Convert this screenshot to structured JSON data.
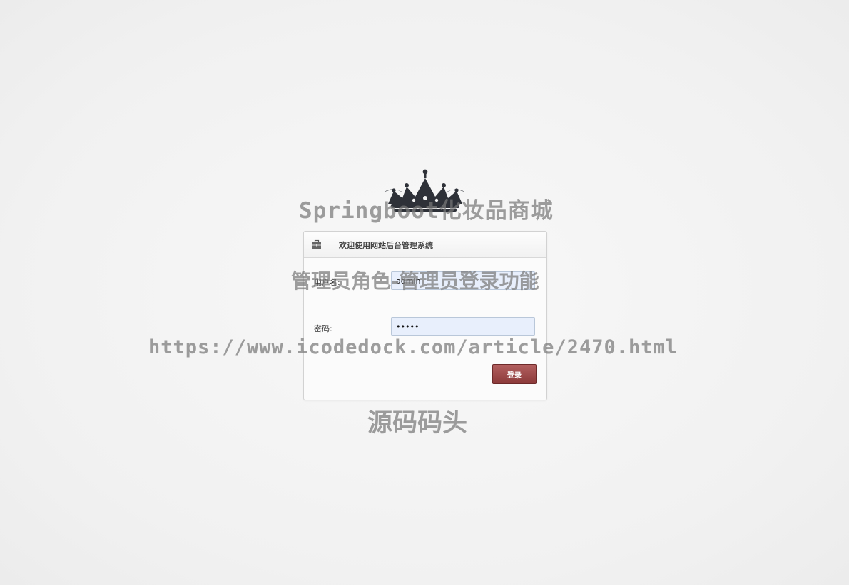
{
  "login": {
    "header_title": "欢迎使用网站后台管理系统",
    "username_label": "用户名:",
    "username_value": "admin",
    "password_label": "密码:",
    "password_value": "•••••",
    "submit_label": "登录"
  },
  "watermarks": {
    "line1": "Springboot化妆品商城",
    "line2": "管理员角色-管理员登录功能",
    "line3": "https://www.icodedock.com/article/2470.html",
    "line4": "源码码头"
  },
  "icons": {
    "logo": "crown-icon",
    "header": "briefcase-icon"
  },
  "colors": {
    "button": "#9b4646",
    "input_bg": "#e8effc",
    "logo": "#2e3138"
  }
}
